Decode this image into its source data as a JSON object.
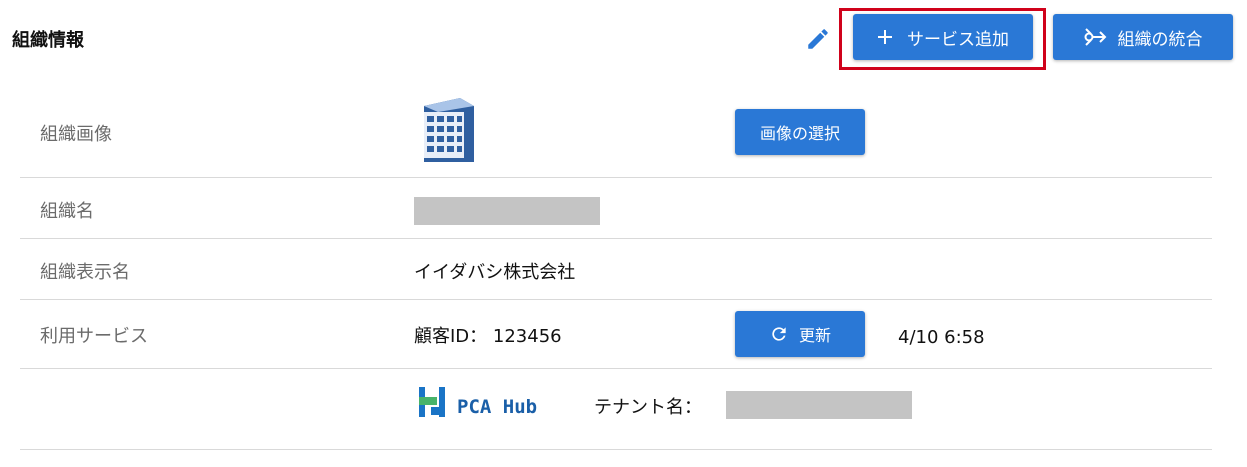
{
  "header": {
    "title": "組織情報",
    "add_service_label": "サービス追加",
    "merge_label": "組織の統合"
  },
  "rows": {
    "image": {
      "label": "組織画像",
      "select_label": "画像の選択"
    },
    "name": {
      "label": "組織名"
    },
    "display_name": {
      "label": "組織表示名",
      "value": "イイダバシ株式会社"
    },
    "services": {
      "label": "利用サービス",
      "customer_id": "顧客ID： 123456",
      "refresh_label": "更新",
      "timestamp": "4/10 6:58"
    },
    "hub": {
      "logo_text": "PCA Hub",
      "tenant_label": "テナント名："
    }
  },
  "colors": {
    "primary": "#2a78d6",
    "highlight": "#d0021b",
    "redacted": "#c4c4c4",
    "label": "#6b6b6b"
  },
  "icons": [
    "edit-icon",
    "plus-icon",
    "merge-icon",
    "building-icon",
    "refresh-icon",
    "pca-hub-logo"
  ]
}
